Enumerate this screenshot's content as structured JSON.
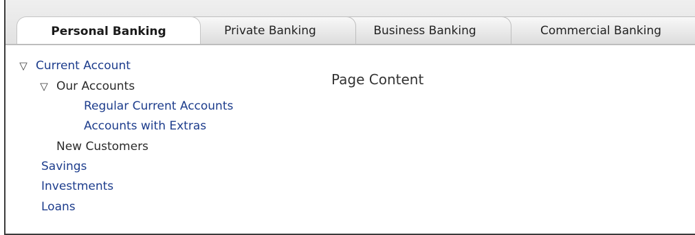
{
  "tabs": [
    {
      "label": "Personal Banking",
      "active": true
    },
    {
      "label": "Private Banking",
      "active": false
    },
    {
      "label": "Business Banking",
      "active": false
    },
    {
      "label": "Commercial Banking",
      "active": false
    }
  ],
  "nav": {
    "expand_icon": "▽",
    "current_account": "Current Account",
    "our_accounts": "Our Accounts",
    "regular_current_accounts": "Regular Current Accounts",
    "accounts_with_extras": "Accounts with Extras",
    "new_customers": "New Customers",
    "savings": "Savings",
    "investments": "Investments",
    "loans": "Loans"
  },
  "content": {
    "text": "Page Content"
  },
  "colors": {
    "link": "#1c3c8c",
    "text": "#2a2a2a",
    "tab_bar": "#e4e4e4",
    "border": "#3a3a3a"
  }
}
